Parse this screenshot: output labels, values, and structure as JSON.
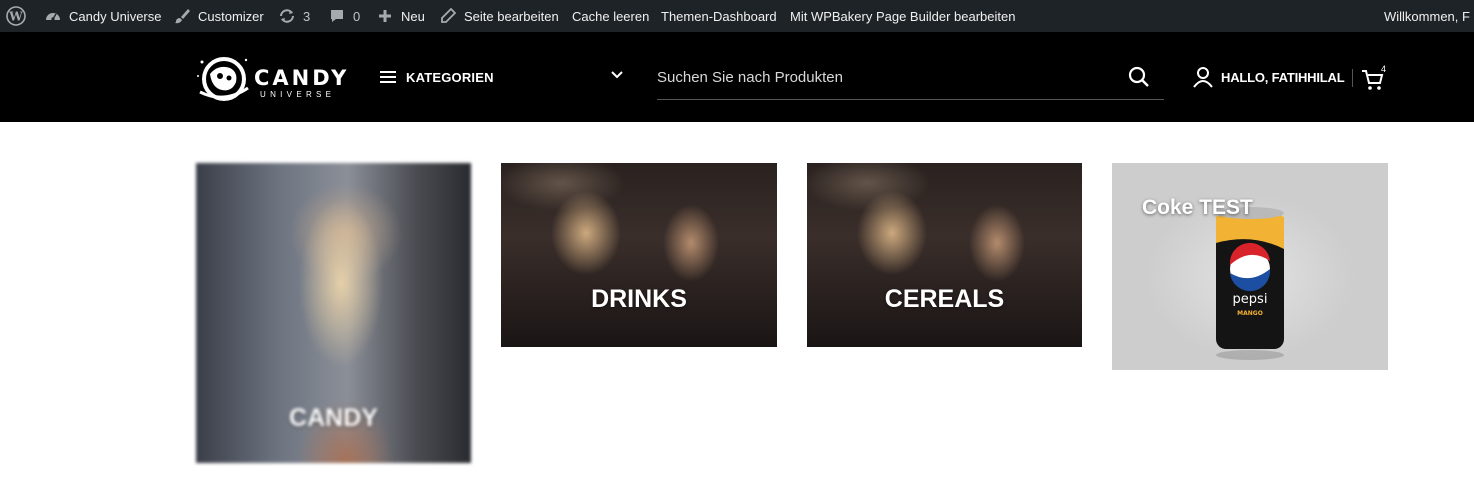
{
  "adminbar": {
    "site_name": "Candy Universe",
    "customizer": "Customizer",
    "updates_count": "3",
    "comments_count": "0",
    "new_label": "Neu",
    "edit_page": "Seite bearbeiten",
    "clear_cache": "Cache leeren",
    "theme_dashboard": "Themen-Dashboard",
    "wpbakery": "Mit WPBakery Page Builder bearbeiten",
    "welcome": "Willkommen, F"
  },
  "header": {
    "logo_brand": "CANDY",
    "logo_sub": "UNIVERSE",
    "categories_label": "KATEGORIEN",
    "search_placeholder": "Suchen Sie nach Produkten",
    "account_greeting": "HALLO, FATIHHILAL",
    "cart_count": "4"
  },
  "tiles": [
    {
      "label": "CANDY"
    },
    {
      "label": "DRINKS"
    },
    {
      "label": "CEREALS"
    },
    {
      "label": "Coke TEST"
    }
  ],
  "product_image": {
    "brand": "pepsi",
    "flavor": "MANGO"
  },
  "colors": {
    "adminbar_bg": "#1d2327",
    "header_bg": "#000000",
    "page_bg": "#ffffff"
  }
}
